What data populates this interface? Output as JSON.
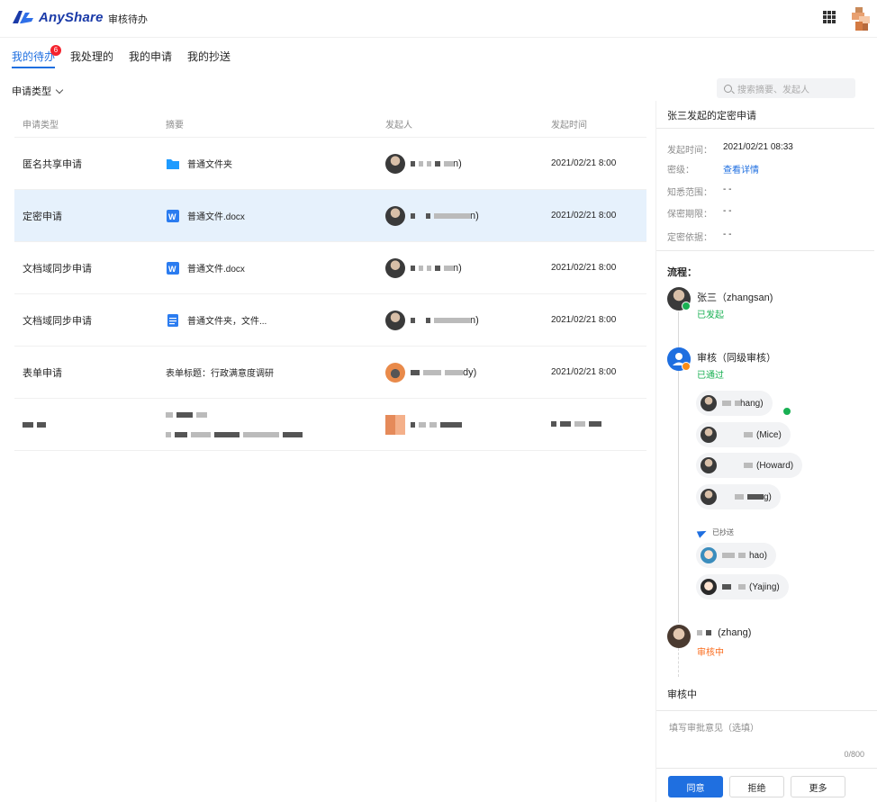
{
  "app": {
    "brand": "AnyShare",
    "page_title": "审核待办"
  },
  "tabs": [
    {
      "label": "我的待办",
      "badge": "6",
      "active": true
    },
    {
      "label": "我处理的"
    },
    {
      "label": "我的申请"
    },
    {
      "label": "我的抄送"
    }
  ],
  "filter": {
    "label": "申请类型"
  },
  "search": {
    "placeholder": "搜索摘要、发起人"
  },
  "table": {
    "headers": [
      "申请类型",
      "摘要",
      "发起人",
      "发起时间"
    ],
    "rows": [
      {
        "type": "匿名共享申请",
        "summary": "普通文件夹",
        "icon": "folder-icon",
        "initiator_suffix": "n)",
        "time": "2021/02/21 8:00"
      },
      {
        "type": "定密申请",
        "summary": "普通文件.docx",
        "icon": "word-doc-icon",
        "initiator_suffix": "n)",
        "time": "2021/02/21 8:00",
        "selected": true
      },
      {
        "type": "文档域同步申请",
        "summary": "普通文件.docx",
        "icon": "word-doc-icon",
        "initiator_suffix": "n)",
        "time": "2021/02/21 8:00"
      },
      {
        "type": "文档域同步申请",
        "summary": "普通文件夹，文件...",
        "icon": "multi-file-icon",
        "initiator_suffix": "n)",
        "time": "2021/02/21 8:00"
      },
      {
        "type": "表单申请",
        "summary": "表单标题：行政满意度调研",
        "icon": "",
        "initiator_suffix": "dy)",
        "time": "2021/02/21 8:00"
      }
    ]
  },
  "detail": {
    "title": "张三发起的定密申请",
    "meta": [
      {
        "label": "发起时间：",
        "value": "2021/02/21 08:33"
      },
      {
        "label": "密级：",
        "value": "查看详情",
        "link": true
      },
      {
        "label": "知悉范围：",
        "value": "- -"
      },
      {
        "label": "保密期限：",
        "value": "- -"
      },
      {
        "label": "定密依据：",
        "value": "- -"
      }
    ],
    "flow_label": "流程：",
    "flow": {
      "initiator": {
        "name": "张三（zhangsan)",
        "status": "已发起"
      },
      "review": {
        "name": "审核（同级审核）",
        "status": "已通过"
      },
      "reviewers": [
        "hang)",
        "(Mice)",
        "(Howard)",
        "g)"
      ],
      "cc_label": "已抄送",
      "cc": [
        "hao)",
        "(Yajing)"
      ],
      "current": {
        "name": "(zhang)",
        "status": "审核中"
      }
    },
    "reviewing_label": "审核中",
    "comment_placeholder": "填写审批意见（选填）",
    "comment_count": "0/800",
    "buttons": {
      "approve": "同意",
      "reject": "拒绝",
      "more": "更多"
    }
  },
  "colors": {
    "accent": "#1f6fe0",
    "success": "#19b053",
    "warning": "#fa6b1c",
    "badge": "#f5222d"
  }
}
